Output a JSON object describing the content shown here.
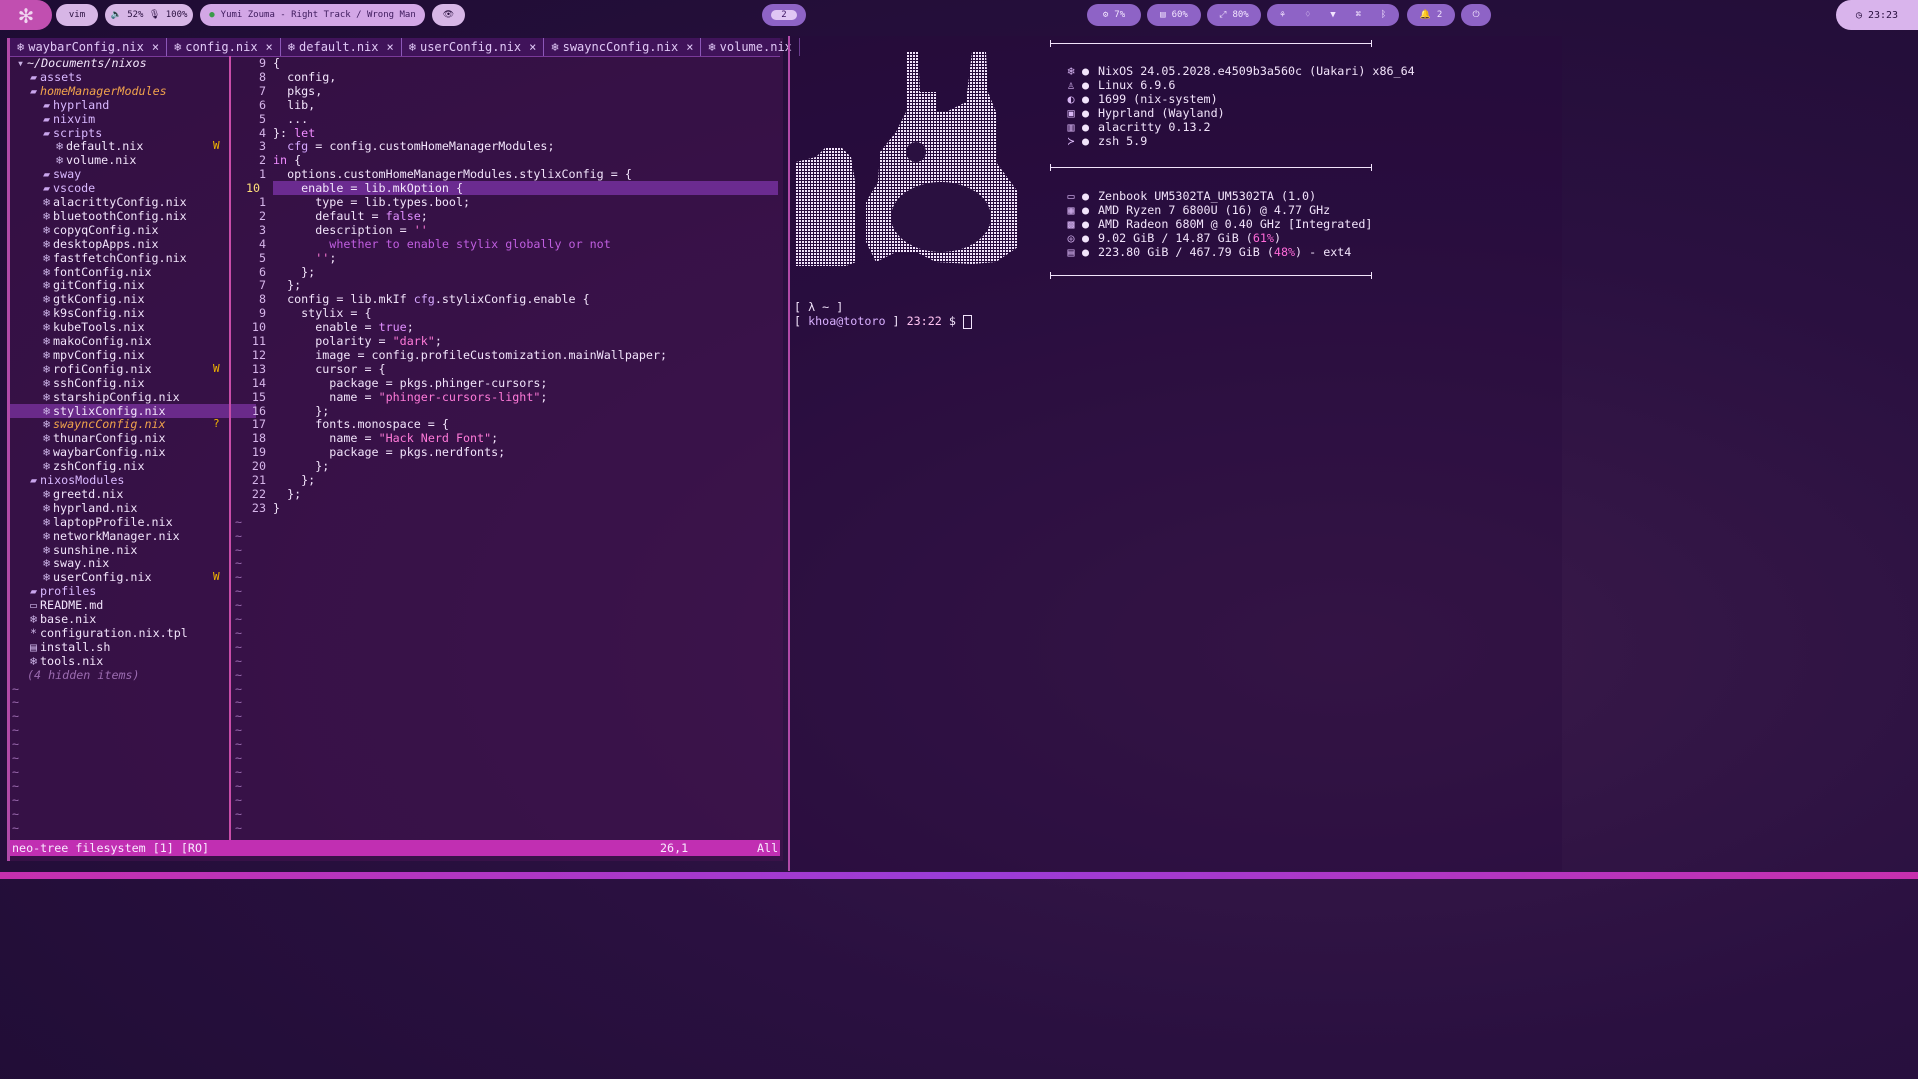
{
  "topbar": {
    "arch_icon": "nix-snowflake-icon",
    "mode": "vim",
    "volume": "🔈 52% 🎙 100%",
    "media": "Yumi Zouma - Right Track / Wrong Man",
    "workspace": "2",
    "cpu": "7%",
    "mem": "60%",
    "disk": "80%",
    "notifications": "2",
    "clock": "23:23"
  },
  "nvim": {
    "tabs": [
      "waybarConfig.nix",
      "config.nix",
      "default.nix",
      "userConfig.nix",
      "swayncConfig.nix",
      "volume.nix"
    ],
    "tree_root": "~/Documents/nixos",
    "tree": [
      {
        "name": "assets",
        "type": "dir",
        "depth": 1
      },
      {
        "name": "homeManagerModules",
        "type": "dir-open",
        "depth": 1
      },
      {
        "name": "hyprland",
        "type": "dir",
        "depth": 2
      },
      {
        "name": "nixvim",
        "type": "dir",
        "depth": 2
      },
      {
        "name": "scripts",
        "type": "dir",
        "depth": 2
      },
      {
        "name": "default.nix",
        "type": "nix",
        "depth": 3,
        "flag": "W"
      },
      {
        "name": "volume.nix",
        "type": "nix",
        "depth": 3
      },
      {
        "name": "sway",
        "type": "dir",
        "depth": 2
      },
      {
        "name": "vscode",
        "type": "dir",
        "depth": 2
      },
      {
        "name": "alacrittyConfig.nix",
        "type": "nix",
        "depth": 2
      },
      {
        "name": "bluetoothConfig.nix",
        "type": "nix",
        "depth": 2
      },
      {
        "name": "copyqConfig.nix",
        "type": "nix",
        "depth": 2
      },
      {
        "name": "desktopApps.nix",
        "type": "nix",
        "depth": 2
      },
      {
        "name": "fastfetchConfig.nix",
        "type": "nix",
        "depth": 2
      },
      {
        "name": "fontConfig.nix",
        "type": "nix",
        "depth": 2
      },
      {
        "name": "gitConfig.nix",
        "type": "nix",
        "depth": 2
      },
      {
        "name": "gtkConfig.nix",
        "type": "nix",
        "depth": 2
      },
      {
        "name": "k9sConfig.nix",
        "type": "nix",
        "depth": 2
      },
      {
        "name": "kubeTools.nix",
        "type": "nix",
        "depth": 2
      },
      {
        "name": "makoConfig.nix",
        "type": "nix",
        "depth": 2
      },
      {
        "name": "mpvConfig.nix",
        "type": "nix",
        "depth": 2
      },
      {
        "name": "rofiConfig.nix",
        "type": "nix",
        "depth": 2,
        "flag": "W"
      },
      {
        "name": "sshConfig.nix",
        "type": "nix",
        "depth": 2
      },
      {
        "name": "starshipConfig.nix",
        "type": "nix",
        "depth": 2
      },
      {
        "name": "stylixConfig.nix",
        "type": "nix",
        "depth": 2,
        "selected": true
      },
      {
        "name": "swayncConfig.nix",
        "type": "nix-untracked",
        "depth": 2,
        "flag": "?"
      },
      {
        "name": "thunarConfig.nix",
        "type": "nix",
        "depth": 2
      },
      {
        "name": "waybarConfig.nix",
        "type": "nix",
        "depth": 2
      },
      {
        "name": "zshConfig.nix",
        "type": "nix",
        "depth": 2
      },
      {
        "name": "nixosModules",
        "type": "dir",
        "depth": 1
      },
      {
        "name": "greetd.nix",
        "type": "nix",
        "depth": 2
      },
      {
        "name": "hyprland.nix",
        "type": "nix",
        "depth": 2
      },
      {
        "name": "laptopProfile.nix",
        "type": "nix",
        "depth": 2
      },
      {
        "name": "networkManager.nix",
        "type": "nix",
        "depth": 2
      },
      {
        "name": "sunshine.nix",
        "type": "nix",
        "depth": 2
      },
      {
        "name": "sway.nix",
        "type": "nix",
        "depth": 2
      },
      {
        "name": "userConfig.nix",
        "type": "nix",
        "depth": 2,
        "flag": "W"
      },
      {
        "name": "profiles",
        "type": "dir",
        "depth": 1
      },
      {
        "name": "README.md",
        "type": "md",
        "depth": 1
      },
      {
        "name": "base.nix",
        "type": "nix",
        "depth": 1
      },
      {
        "name": "configuration.nix.tpl",
        "type": "tpl",
        "depth": 1
      },
      {
        "name": "install.sh",
        "type": "sh",
        "depth": 1
      },
      {
        "name": "tools.nix",
        "type": "nix",
        "depth": 1
      },
      {
        "name": "(4 hidden items)",
        "type": "hidden",
        "depth": 1
      }
    ],
    "line_numbers": [
      "9",
      "8",
      "7",
      "6",
      "5",
      "4",
      "3",
      "2",
      "1",
      "10",
      "1",
      "2",
      "3",
      "4",
      "5",
      "6",
      "7",
      "8",
      "9",
      "10",
      "11",
      "12",
      "13",
      "14",
      "15",
      "16",
      "17",
      "18",
      "19",
      "20",
      "21",
      "22",
      "23"
    ],
    "current_line_index": 9,
    "code": [
      "{",
      "  config,",
      "  pkgs,",
      "  lib,",
      "  ...",
      "}: let",
      "  cfg = config.customHomeManagerModules;",
      "in {",
      "  options.customHomeManagerModules.stylixConfig = {",
      "    enable = lib.mkOption {",
      "      type = lib.types.bool;",
      "      default = false;",
      "      description = ''",
      "        whether to enable stylix globally or not",
      "      '';",
      "    };",
      "  };",
      "  config = lib.mkIf cfg.stylixConfig.enable {",
      "    stylix = {",
      "      enable = true;",
      "      polarity = \"dark\";",
      "      image = config.profileCustomization.mainWallpaper;",
      "      cursor = {",
      "        package = pkgs.phinger-cursors;",
      "        name = \"phinger-cursors-light\";",
      "      };",
      "      fonts.monospace = {",
      "        name = \"Hack Nerd Font\";",
      "        package = pkgs.nerdfonts;",
      "      };",
      "    };",
      "  };",
      "}"
    ],
    "status": {
      "left": "neo-tree filesystem [1] [RO]",
      "pos": "26,1",
      "scroll": "All"
    }
  },
  "terminal": {
    "info_top": [
      {
        "icon": "nix-icon",
        "text": "NixOS 24.05.2028.e4509b3a560c (Uakari) x86_64"
      },
      {
        "icon": "penguin-icon",
        "text": "Linux 6.9.6"
      },
      {
        "icon": "package-icon",
        "text": "1699 (nix-system)"
      },
      {
        "icon": "window-icon",
        "text": "Hyprland (Wayland)"
      },
      {
        "icon": "terminal-icon",
        "text": "alacritty 0.13.2"
      },
      {
        "icon": "shell-icon",
        "text": "zsh 5.9"
      }
    ],
    "info_bottom": [
      {
        "icon": "laptop-icon",
        "text": "Zenbook UM5302TA_UM5302TA (1.0)"
      },
      {
        "icon": "cpu-icon",
        "text": "AMD Ryzen 7 6800U (16) @ 4.77 GHz"
      },
      {
        "icon": "gpu-icon",
        "text": "AMD Radeon 680M @ 0.40 GHz [Integrated]"
      },
      {
        "icon": "memory-icon",
        "text": "9.02 GiB / 14.87 GiB (",
        "pct": "61%",
        "tail": ")"
      },
      {
        "icon": "disk-icon",
        "text": "223.80 GiB / 467.79 GiB (",
        "pct": "48%",
        "tail": ") - ext4"
      }
    ],
    "prompt1": "[ λ ~ ]",
    "prompt2_open": "[ ",
    "prompt2_user": "khoa@totoro",
    "prompt2_mid": " ] ",
    "prompt2_time": "23:22",
    "prompt2_end": " $ "
  }
}
